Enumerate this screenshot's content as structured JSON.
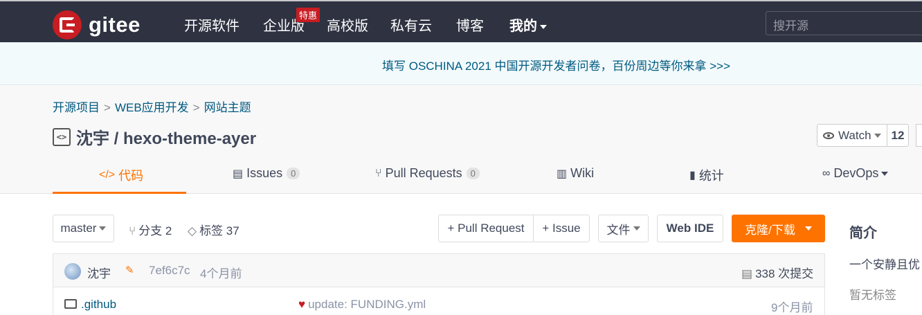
{
  "topnav": {
    "logo_text": "gitee",
    "items": [
      "开源软件",
      "企业版",
      "高校版",
      "私有云",
      "博客",
      "我的"
    ],
    "hot_badge": "特惠",
    "search_placeholder": "搜开源"
  },
  "banner": {
    "text": "填写 OSCHINA 2021 中国开源开发者问卷，百份周边等你来拿 >>>"
  },
  "breadcrumb": [
    "开源项目",
    "WEB应用开发",
    "网站主题"
  ],
  "repo": {
    "name": "沈宇 / hexo-theme-ayer",
    "watch_label": "Watch",
    "watch_count": "12"
  },
  "tabs": [
    {
      "label": "代码",
      "icon": "code-icon"
    },
    {
      "label": "Issues",
      "count": "0",
      "icon": "issues-icon"
    },
    {
      "label": "Pull Requests",
      "count": "0",
      "icon": "pull-request-icon"
    },
    {
      "label": "Wiki",
      "icon": "wiki-icon"
    },
    {
      "label": "统计",
      "icon": "stats-icon"
    },
    {
      "label": "DevOps",
      "icon": "devops-icon"
    }
  ],
  "toolbar": {
    "branch": "master",
    "branches": "分支 2",
    "tags": "标签 37",
    "pull_request": "+ Pull Request",
    "issue": "+ Issue",
    "file": "文件",
    "web_ide": "Web IDE",
    "clone": "克隆/下载"
  },
  "commit": {
    "author": "沈宇",
    "hash": "7ef6c7c",
    "time": "4个月前",
    "commits": "338 次提交"
  },
  "files": [
    {
      "name": ".github",
      "message": "update: FUNDING.yml",
      "time": "9个月前"
    }
  ],
  "sidebar": {
    "title": "简介",
    "description": "一个安静且优",
    "tags": "暂无标签"
  },
  "colors": {
    "accent": "#fe7300",
    "topbar": "#2e3241",
    "brand": "#c71d23",
    "link": "#005980"
  }
}
